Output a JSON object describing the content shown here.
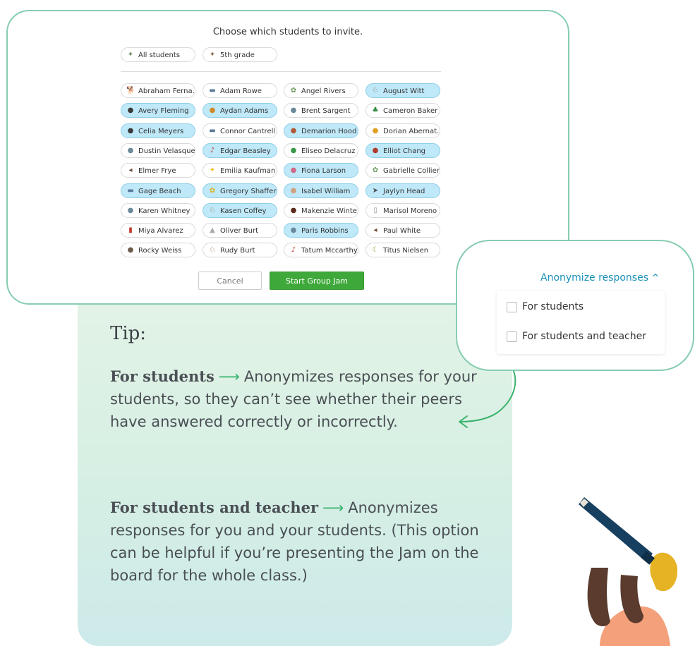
{
  "dialog": {
    "title": "Choose which students to invite.",
    "groups": [
      {
        "label": "All students",
        "icon": "group-icon"
      },
      {
        "label": "5th grade",
        "icon": "group-icon"
      }
    ],
    "students": [
      {
        "name": "Abraham Ferna...",
        "selected": false,
        "icon": "dog-icon"
      },
      {
        "name": "Adam Rowe",
        "selected": false,
        "icon": "car-icon"
      },
      {
        "name": "Angel Rivers",
        "selected": false,
        "icon": "bird-icon"
      },
      {
        "name": "August Witt",
        "selected": true,
        "icon": "goat-icon"
      },
      {
        "name": "Avery Fleming",
        "selected": true,
        "icon": "bottle-icon"
      },
      {
        "name": "Aydan Adams",
        "selected": true,
        "icon": "burger-icon"
      },
      {
        "name": "Brent Sargent",
        "selected": false,
        "icon": "figure-icon"
      },
      {
        "name": "Cameron Baker",
        "selected": false,
        "icon": "tree-icon"
      },
      {
        "name": "Celia Meyers",
        "selected": true,
        "icon": "bottle-icon"
      },
      {
        "name": "Connor Cantrell",
        "selected": false,
        "icon": "car-icon"
      },
      {
        "name": "Demarion Hood",
        "selected": true,
        "icon": "shell-icon"
      },
      {
        "name": "Dorian Abernat...",
        "selected": false,
        "icon": "chicken-icon"
      },
      {
        "name": "Dustin Velasquez",
        "selected": false,
        "icon": "figure-icon"
      },
      {
        "name": "Edgar Beasley",
        "selected": true,
        "icon": "guitar-icon"
      },
      {
        "name": "Eliseo Delacruz",
        "selected": false,
        "icon": "frog-icon"
      },
      {
        "name": "Elliot Chang",
        "selected": true,
        "icon": "donut-icon"
      },
      {
        "name": "Elmer Frye",
        "selected": false,
        "icon": "fish-icon"
      },
      {
        "name": "Emilia Kaufman",
        "selected": false,
        "icon": "star-icon"
      },
      {
        "name": "Fiona Larson",
        "selected": true,
        "icon": "ball-icon"
      },
      {
        "name": "Gabrielle Collier",
        "selected": false,
        "icon": "bird-icon"
      },
      {
        "name": "Gage Beach",
        "selected": true,
        "icon": "car-icon"
      },
      {
        "name": "Gregory Shaffer",
        "selected": true,
        "icon": "flower-icon"
      },
      {
        "name": "Isabel William",
        "selected": true,
        "icon": "egg-icon"
      },
      {
        "name": "Jaylyn Head",
        "selected": true,
        "icon": "plane-icon"
      },
      {
        "name": "Karen Whitney",
        "selected": false,
        "icon": "figure-icon"
      },
      {
        "name": "Kasen Coffey",
        "selected": true,
        "icon": "goat-icon"
      },
      {
        "name": "Makenzie Winte...",
        "selected": false,
        "icon": "bull-icon"
      },
      {
        "name": "Marisol Moreno",
        "selected": false,
        "icon": "glass-icon"
      },
      {
        "name": "Miya Alvarez",
        "selected": false,
        "icon": "hydrant-icon"
      },
      {
        "name": "Oliver Burt",
        "selected": false,
        "icon": "cone-icon"
      },
      {
        "name": "Paris Robbins",
        "selected": true,
        "icon": "figure-icon"
      },
      {
        "name": "Paul White",
        "selected": false,
        "icon": "fish-icon"
      },
      {
        "name": "Rocky Weiss",
        "selected": false,
        "icon": "rock-icon"
      },
      {
        "name": "Rudy Burt",
        "selected": false,
        "icon": "goat-icon"
      },
      {
        "name": "Tatum Mccarthy",
        "selected": false,
        "icon": "guitar-icon"
      },
      {
        "name": "Titus Nielsen",
        "selected": false,
        "icon": "banana-icon"
      }
    ],
    "cancel_label": "Cancel",
    "start_label": "Start Group Jam"
  },
  "anonymize": {
    "toggle_label": "Anonymize responses",
    "toggle_icon": "chevron-up-icon",
    "options": [
      "For students",
      "For students and teacher"
    ]
  },
  "tip": {
    "title": "Tip:",
    "items": [
      {
        "term": "For students",
        "description": "Anonymizes responses for your students, so they can’t see whether their peers have answered correctly or incorrectly."
      },
      {
        "term": "For students and teacher",
        "description": "Anonymizes responses for you and your students. (This option can be helpful if you’re presenting the Jam on the board for the whole class.)"
      }
    ]
  },
  "colors": {
    "accent": "#3fa83a",
    "selected_chip": "#bfe8f8",
    "link": "#1a90b8",
    "frame": "#86cdb0",
    "tip_bg": "#dff1e6"
  }
}
